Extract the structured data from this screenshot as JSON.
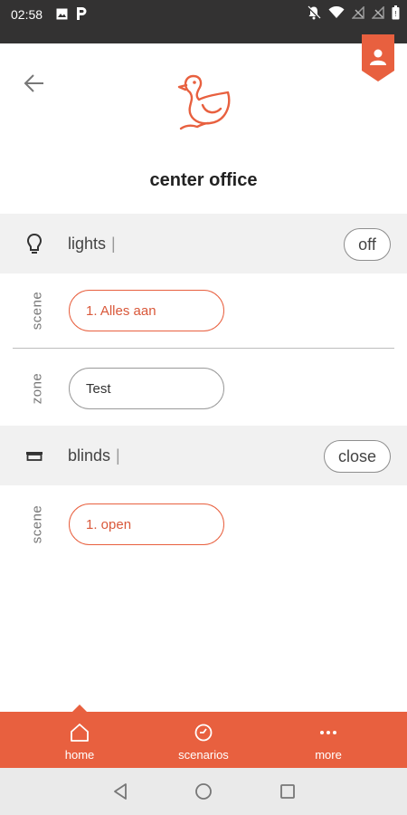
{
  "status_bar": {
    "time": "02:58",
    "left_icons": [
      "image-icon",
      "p-icon"
    ],
    "right_icons": [
      "mute-bell-icon",
      "wifi-icon",
      "no-signal-icon",
      "no-signal-icon",
      "battery-icon"
    ]
  },
  "header": {
    "title": "center office",
    "back_icon": "arrow-left-icon",
    "logo_icon": "duck-logo-icon",
    "profile_icon": "profile-badge-icon"
  },
  "groups": [
    {
      "name": "lights",
      "icon": "lightbulb-icon",
      "separator": "|",
      "action_label": "off",
      "rows": [
        {
          "label": "scene",
          "value": "1. Alles aan",
          "accent": true
        },
        {
          "label": "zone",
          "value": "Test",
          "accent": false
        }
      ]
    },
    {
      "name": "blinds",
      "icon": "blinds-icon",
      "separator": "|",
      "action_label": "close",
      "rows": [
        {
          "label": "scene",
          "value": "1. open",
          "accent": true
        }
      ]
    }
  ],
  "bottom_nav": {
    "items": [
      {
        "label": "home",
        "icon": "home-icon",
        "active": true
      },
      {
        "label": "scenarios",
        "icon": "clock-icon",
        "active": false
      },
      {
        "label": "more",
        "icon": "dots-icon",
        "active": false
      }
    ]
  },
  "colors": {
    "accent": "#e8603f",
    "status_bar": "#333232",
    "group_bg": "#f1f1f1"
  }
}
